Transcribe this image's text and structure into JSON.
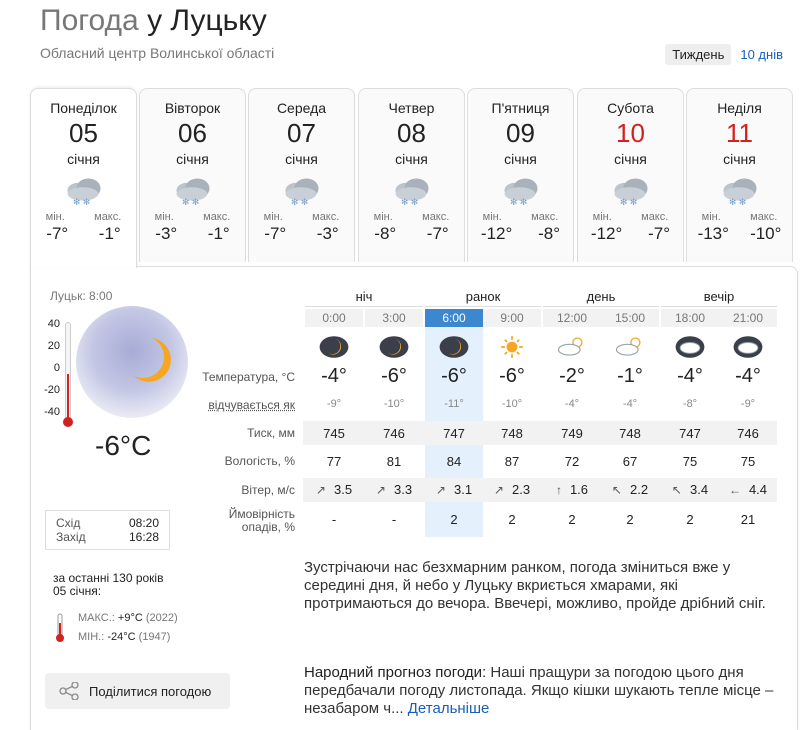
{
  "header": {
    "title_prefix": "Погода ",
    "title_city": "у Луцьку",
    "subtitle": "Обласний центр Волинської області",
    "period_week": "Тиждень",
    "period_10": "10 днів"
  },
  "days": [
    {
      "name": "Понеділок",
      "num": "05",
      "month": "січня",
      "min_label": "мін.",
      "max_label": "макс.",
      "min": "-7°",
      "max": "-1°",
      "red": false,
      "icon": "cloudy-snow-icon"
    },
    {
      "name": "Вівторок",
      "num": "06",
      "month": "січня",
      "min_label": "мін.",
      "max_label": "макс.",
      "min": "-3°",
      "max": "-1°",
      "red": false,
      "icon": "cloudy-snow-icon"
    },
    {
      "name": "Середа",
      "num": "07",
      "month": "січня",
      "min_label": "мін.",
      "max_label": "макс.",
      "min": "-7°",
      "max": "-3°",
      "red": false,
      "icon": "cloudy-snow-icon"
    },
    {
      "name": "Четвер",
      "num": "08",
      "month": "січня",
      "min_label": "мін.",
      "max_label": "макс.",
      "min": "-8°",
      "max": "-7°",
      "red": false,
      "icon": "cloudy-snow-icon"
    },
    {
      "name": "П'ятниця",
      "num": "09",
      "month": "січня",
      "min_label": "мін.",
      "max_label": "макс.",
      "min": "-12°",
      "max": "-8°",
      "red": false,
      "icon": "cloudy-snow-icon"
    },
    {
      "name": "Субота",
      "num": "10",
      "month": "січня",
      "min_label": "мін.",
      "max_label": "макс.",
      "min": "-12°",
      "max": "-7°",
      "red": true,
      "icon": "cloudy-snow-icon"
    },
    {
      "name": "Неділя",
      "num": "11",
      "month": "січня",
      "min_label": "мін.",
      "max_label": "макс.",
      "min": "-13°",
      "max": "-10°",
      "red": true,
      "icon": "cloudy-snow-icon"
    }
  ],
  "now": {
    "city_time": "Луцьк: 8:00",
    "scale": [
      "40",
      "20",
      "0",
      "-20",
      "-40"
    ],
    "temp": "-6°C",
    "sunrise_label": "Схід",
    "sunrise": "08:20",
    "sunset_label": "Захід",
    "sunset": "16:28"
  },
  "history": {
    "line1": "за останні 130 років",
    "line2": "05 січня:",
    "max_label": "МАКС.:",
    "max_val": "+9°C",
    "max_year": "(2022)",
    "min_label": "МІН.:",
    "min_val": "-24°C",
    "min_year": "(1947)"
  },
  "share_label": "Поділитися погодою",
  "segments": [
    "ніч",
    "ранок",
    "день",
    "вечір"
  ],
  "labels": {
    "temp": "Температура, °C",
    "feels": "відчувається як",
    "pressure": "Тиск, мм",
    "humidity": "Вологість, %",
    "wind": "Вітер, м/с",
    "precip1": "Ймовірність",
    "precip2": "опадів, %"
  },
  "hours": [
    {
      "time": "0:00",
      "icon": "moon-cloud-icon",
      "temp": "-4°",
      "feels": "-9°",
      "pressure": "745",
      "humidity": "77",
      "wind_dir": "↗",
      "wind": "3.5",
      "precip": "-"
    },
    {
      "time": "3:00",
      "icon": "moon-cloud-icon",
      "temp": "-6°",
      "feels": "-10°",
      "pressure": "746",
      "humidity": "81",
      "wind_dir": "↗",
      "wind": "3.3",
      "precip": "-"
    },
    {
      "time": "6:00",
      "icon": "moon-cloud-icon",
      "temp": "-6°",
      "feels": "-11°",
      "pressure": "747",
      "humidity": "84",
      "wind_dir": "↗",
      "wind": "3.1",
      "precip": "2"
    },
    {
      "time": "9:00",
      "icon": "sun-icon",
      "temp": "-6°",
      "feels": "-10°",
      "pressure": "748",
      "humidity": "87",
      "wind_dir": "↗",
      "wind": "2.3",
      "precip": "2"
    },
    {
      "time": "12:00",
      "icon": "sun-cloud-icon",
      "temp": "-2°",
      "feels": "-4°",
      "pressure": "749",
      "humidity": "72",
      "wind_dir": "↑",
      "wind": "1.6",
      "precip": "2"
    },
    {
      "time": "15:00",
      "icon": "sun-cloud-icon",
      "temp": "-1°",
      "feels": "-4°",
      "pressure": "748",
      "humidity": "67",
      "wind_dir": "↖",
      "wind": "2.2",
      "precip": "2"
    },
    {
      "time": "18:00",
      "icon": "cloud-icon",
      "temp": "-4°",
      "feels": "-8°",
      "pressure": "747",
      "humidity": "75",
      "wind_dir": "↖",
      "wind": "3.4",
      "precip": "2"
    },
    {
      "time": "21:00",
      "icon": "cloud-icon",
      "temp": "-4°",
      "feels": "-9°",
      "pressure": "746",
      "humidity": "75",
      "wind_dir": "←",
      "wind": "4.4",
      "precip": "21"
    }
  ],
  "description": "Зустрічаючи нас безхмарним ранком, погода зміниться вже у середині дня, й небо у Луцьку вкриється хмарами, які протримаються до вечора. Ввечері, можливо, пройде дрібний сніг.",
  "folk": {
    "title": "Народний прогноз погоди:",
    "text": " Наші пращури за погодою цього дня передбачали погоду листопада. Якщо кішки шукають тепле місце – незабаром ч...",
    "more": "Детальніше"
  }
}
